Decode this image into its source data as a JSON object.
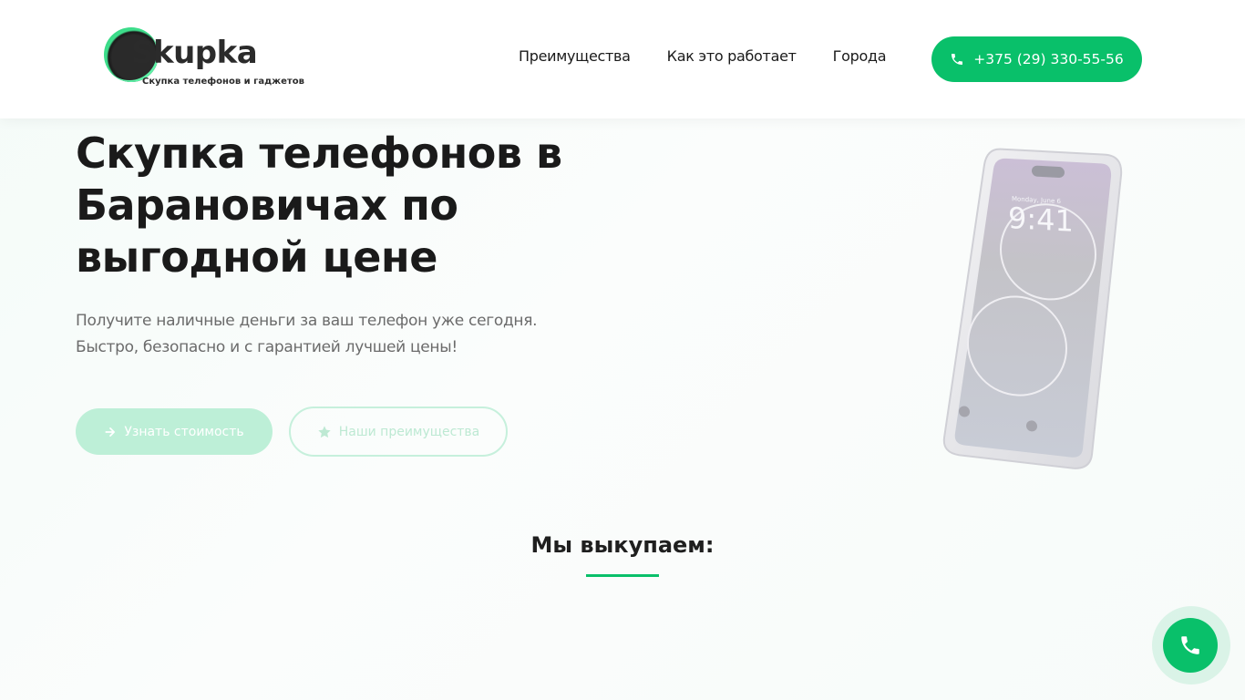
{
  "header": {
    "logo": {
      "brand": "Skupka",
      "tagline": "Скупка телефонов и гаджетов"
    },
    "nav": [
      {
        "label": "Преимущества"
      },
      {
        "label": "Как это работает"
      },
      {
        "label": "Города"
      }
    ],
    "phone_button": {
      "label": "+375 (29) 330-55-56",
      "icon": "phone-icon"
    }
  },
  "hero": {
    "title": "Скупка телефонов в Барановичах по выгодной цене",
    "subtitle_line1": "Получите наличные деньги за ваш телефон уже сегодня.",
    "subtitle_line2": "Быстро, безопасно и с гарантией лучшей цены!",
    "primary_button": {
      "label": "Узнать стоимость",
      "icon": "arrow-right-icon"
    },
    "secondary_button": {
      "label": "Наши преимущества",
      "icon": "star-icon"
    },
    "phone_image": {
      "time": "9:41",
      "date": "Monday, June 6"
    }
  },
  "section": {
    "title": "Мы выкупаем:"
  },
  "floating_call": {
    "icon": "phone-icon"
  },
  "colors": {
    "accent": "#09c06a",
    "accent_light": "#bdefd7",
    "text": "#1a1a1a",
    "muted": "#6b6b6b"
  }
}
